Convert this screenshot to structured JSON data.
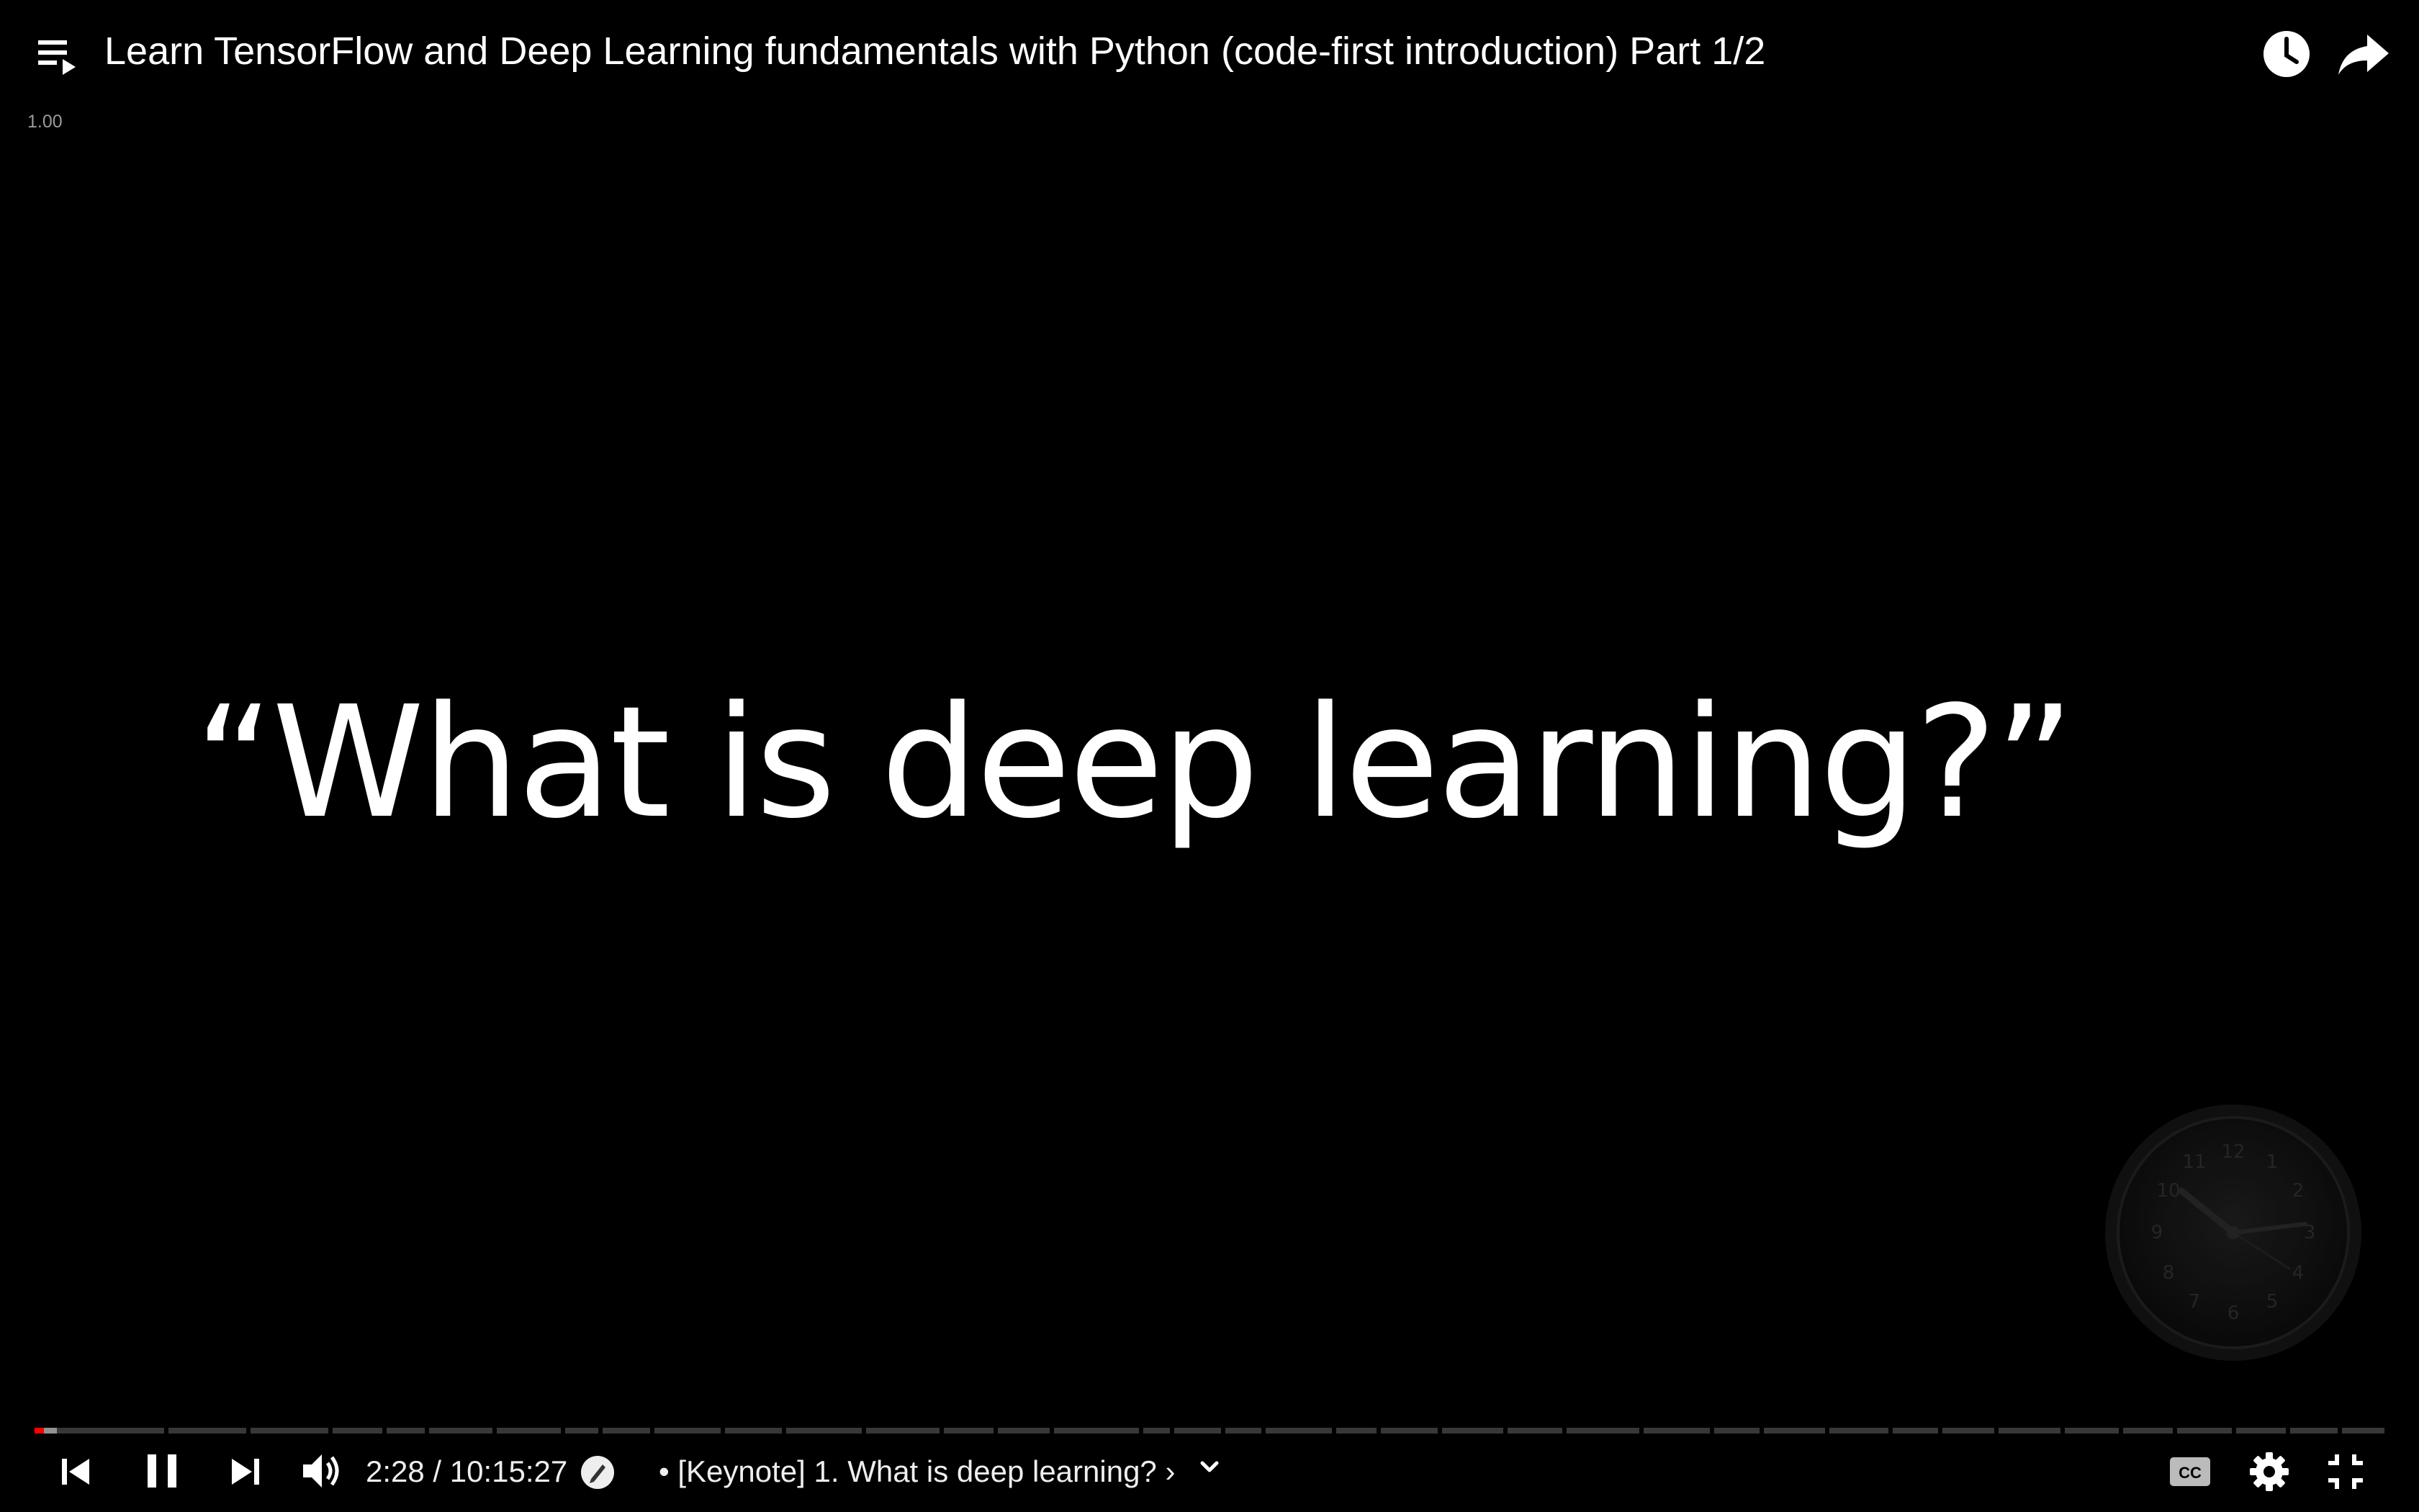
{
  "header": {
    "title": "Learn TensorFlow and Deep Learning fundamentals with Python (code-first introduction) Part 1/2",
    "speed_readout": "1.00"
  },
  "video": {
    "slide_text": "“What is deep learning?”"
  },
  "controls": {
    "current_time": "2:28",
    "duration": "10:15:27",
    "time_display": "2:28 / 10:15:27",
    "chapter_label": "• [Keynote] 1. What is deep learning? ›",
    "progress": {
      "played_fraction": 0.004,
      "buffered_fraction": 0.0095
    }
  },
  "icons": {
    "playlist": "playlist-play-icon",
    "watch_later": "clock-icon",
    "share": "share-arrow-icon",
    "previous": "skip-previous-icon",
    "pause": "pause-icon",
    "next": "skip-next-icon",
    "volume": "volume-icon",
    "cursor": "pen-cursor-icon",
    "chapter_expand": "chevron-down-icon",
    "captions": "closed-captions-icon",
    "settings": "gear-icon",
    "exit_fullscreen": "exit-fullscreen-icon"
  },
  "colors": {
    "background": "#000000",
    "progress_played": "#ff0000",
    "text": "#ffffff"
  }
}
